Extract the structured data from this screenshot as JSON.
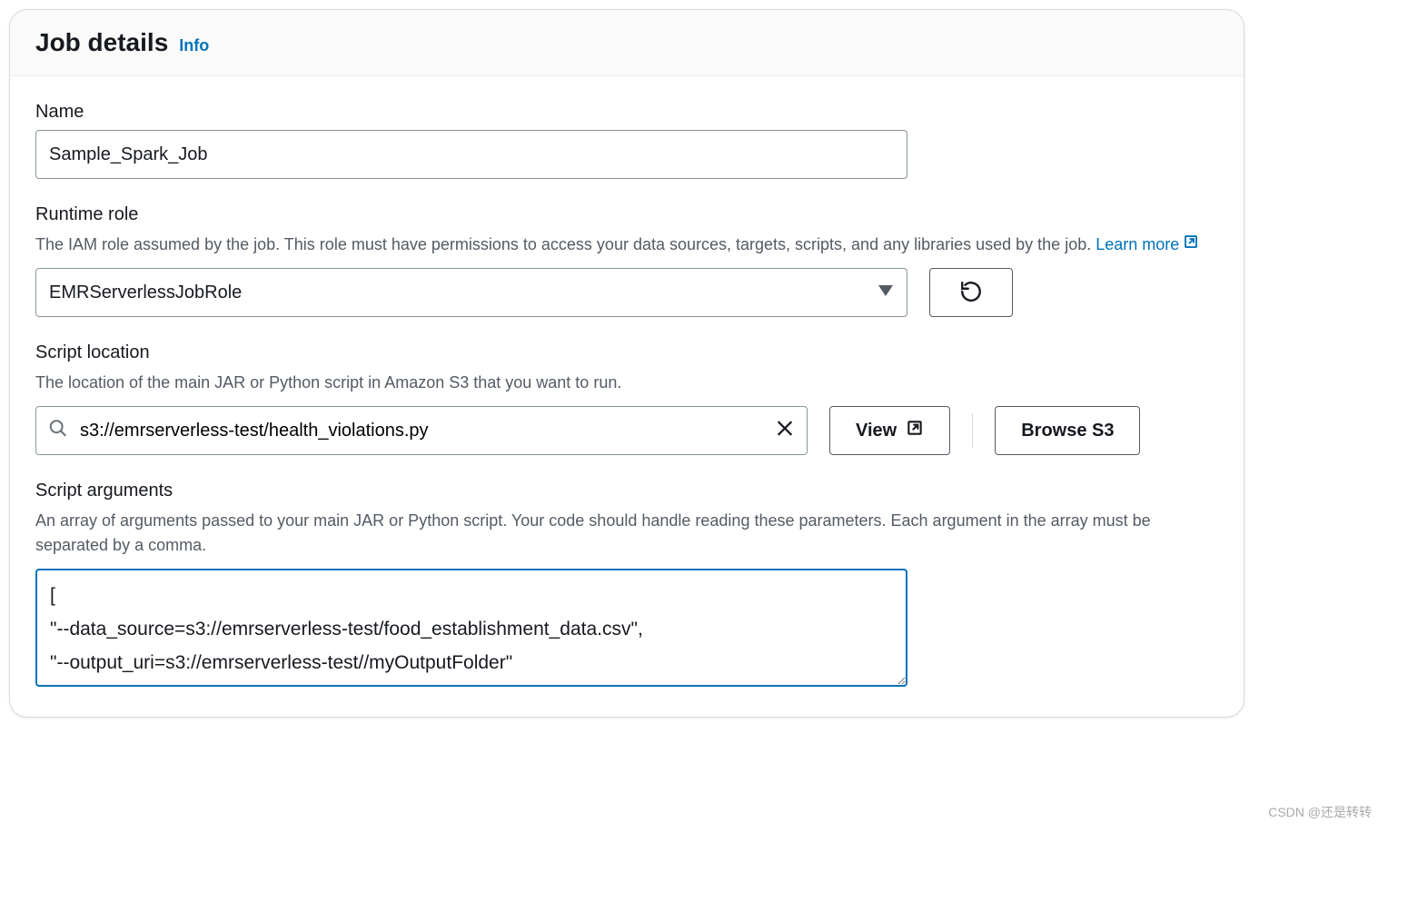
{
  "header": {
    "title": "Job details",
    "info": "Info"
  },
  "name": {
    "label": "Name",
    "value": "Sample_Spark_Job"
  },
  "runtime_role": {
    "label": "Runtime role",
    "hint_prefix": "The IAM role assumed by the job. This role must have permissions to access your data sources, targets, scripts, and any libraries used by the job. ",
    "learn_more": "Learn more",
    "value": "EMRServerlessJobRole"
  },
  "script_location": {
    "label": "Script location",
    "hint": "The location of the main JAR or Python script in Amazon S3 that you want to run.",
    "value": "s3://emrserverless-test/health_violations.py",
    "view": "View",
    "browse": "Browse S3"
  },
  "script_arguments": {
    "label": "Script arguments",
    "hint": "An array of arguments passed to your main JAR or Python script. Your code should handle reading these parameters. Each argument in the array must be separated by a comma.",
    "value": "[\n\"--data_source=s3://emrserverless-test/food_establishment_data.csv\",\n\"--output_uri=s3://emrserverless-test//myOutputFolder\"\n]"
  },
  "watermark": "CSDN @还是转转"
}
